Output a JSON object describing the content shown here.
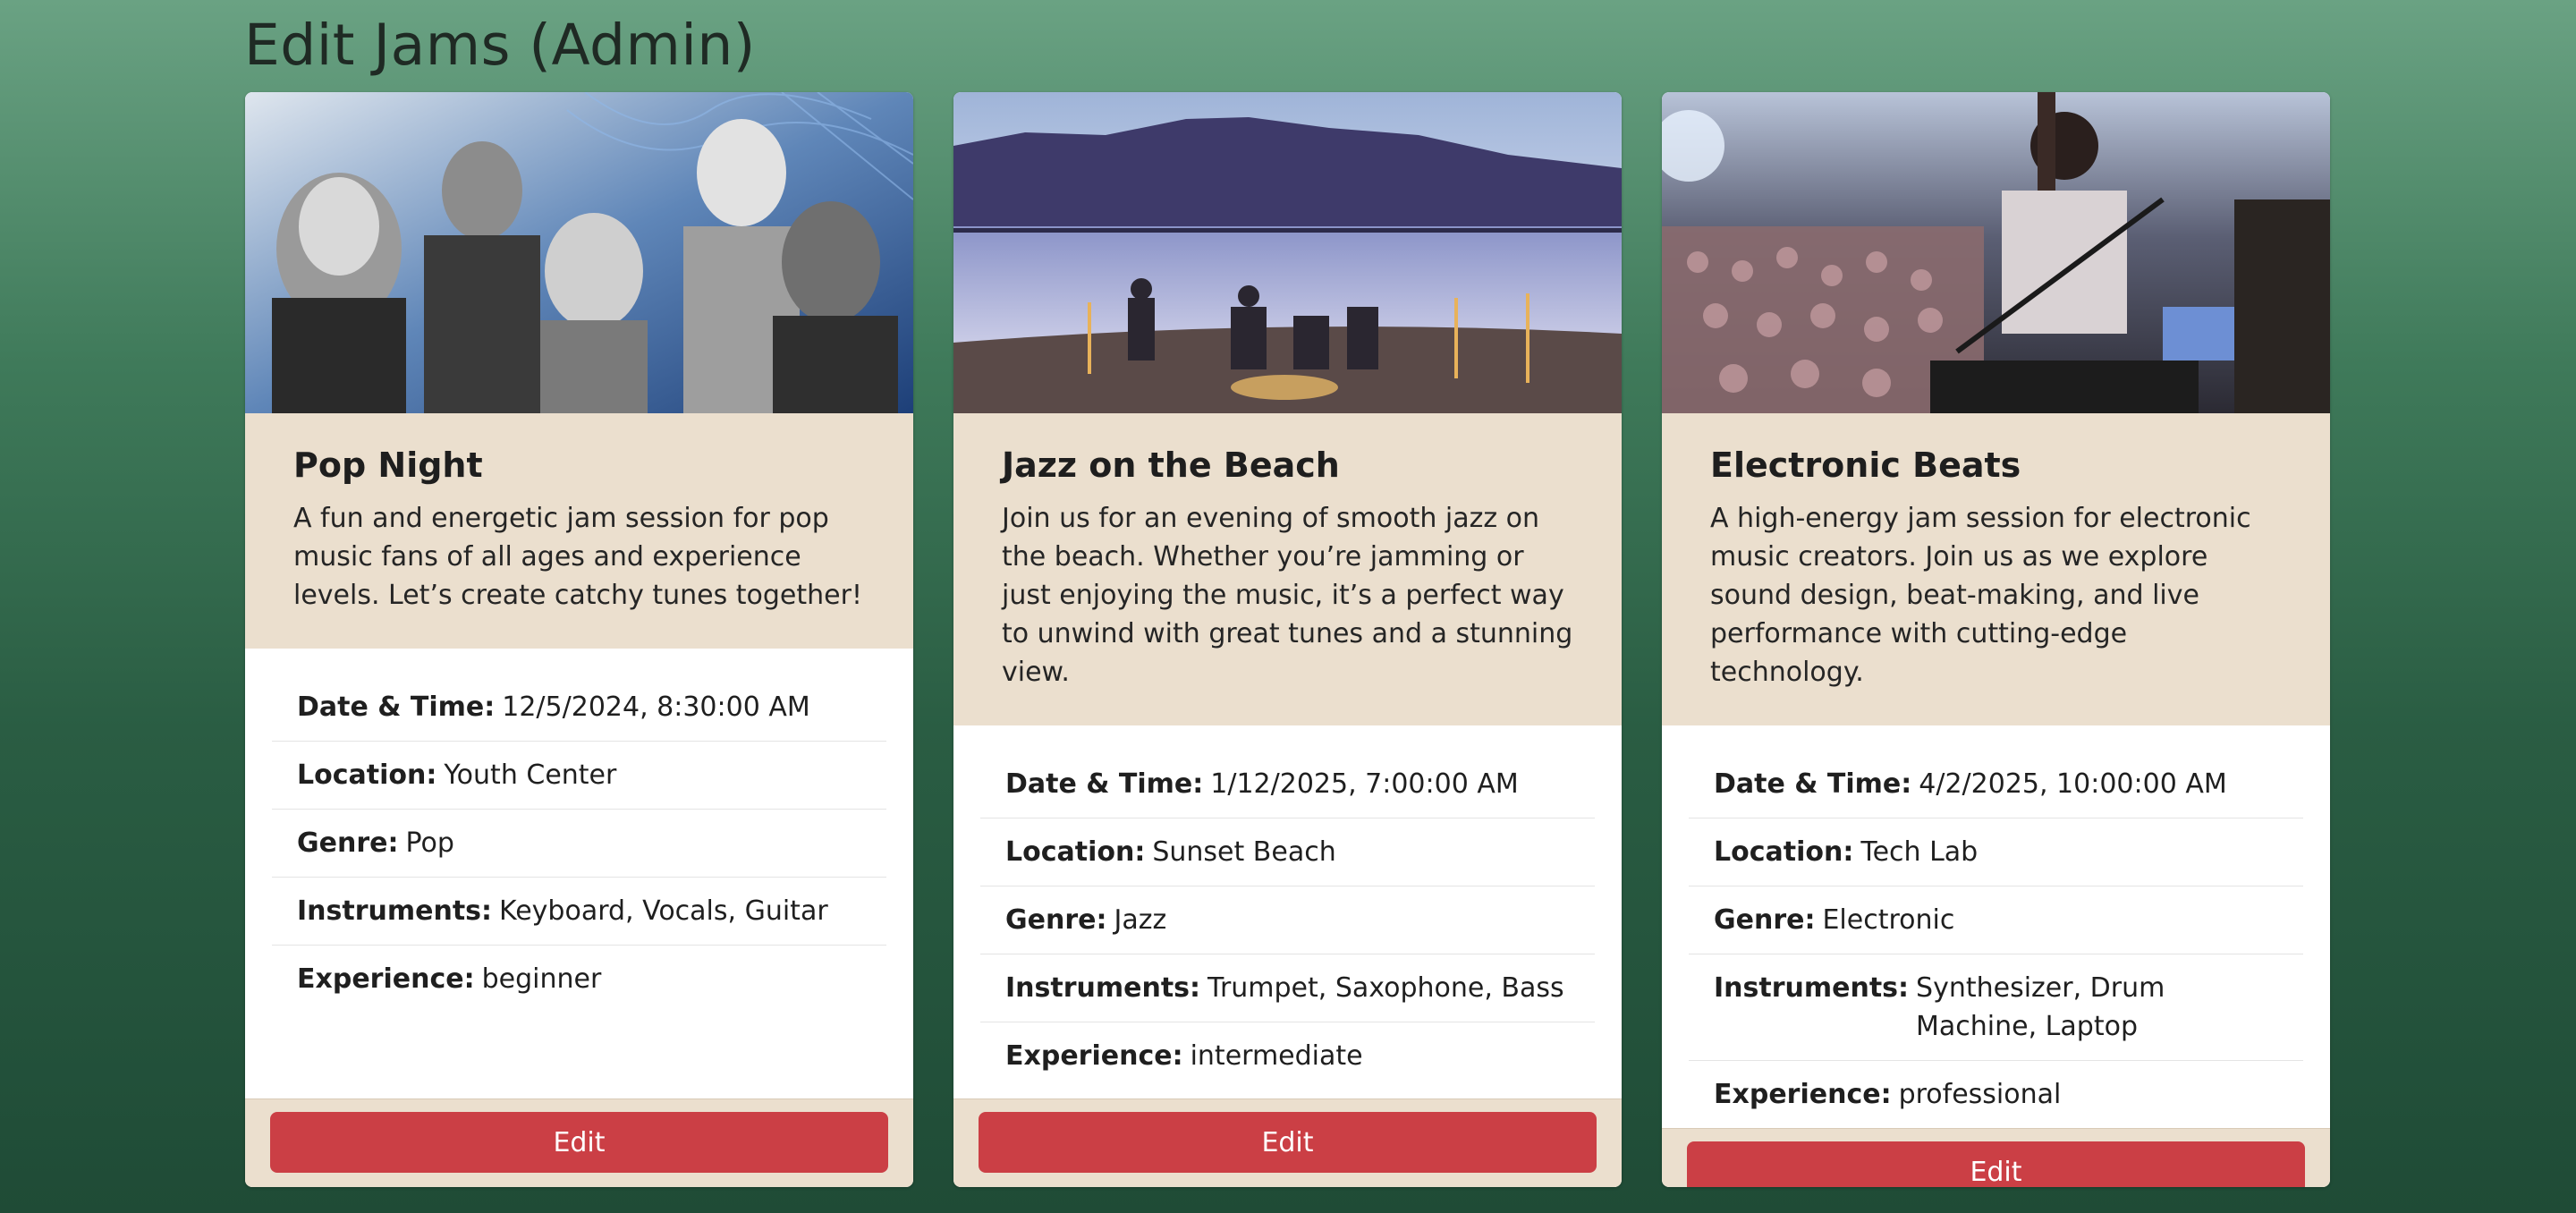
{
  "page": {
    "title": "Edit Jams (Admin)"
  },
  "colors": {
    "background_top": "#6aa283",
    "background_bottom": "#1f4b36",
    "card_accent": "#ebdfce",
    "edit_button": "#cb3f45"
  },
  "cards": [
    {
      "image_name": "pop-artists-collage-image",
      "title": "Pop Night",
      "description": "A fun and energetic jam session for pop music fans of all ages and experience levels. Let’s create catchy tunes together!",
      "details": [
        {
          "label": "Date & Time:",
          "value": "12/5/2024, 8:30:00 AM"
        },
        {
          "label": "Location:",
          "value": "Youth Center"
        },
        {
          "label": "Genre:",
          "value": "Pop"
        },
        {
          "label": "Instruments:",
          "value": "Keyboard, Vocals, Guitar"
        },
        {
          "label": "Experience:",
          "value": "beginner"
        }
      ],
      "button_label": "Edit"
    },
    {
      "image_name": "beach-jazz-image",
      "title": "Jazz on the Beach",
      "description": "Join us for an evening of smooth jazz on the beach. Whether you’re jamming or just enjoying the music, it’s a perfect way to unwind with great tunes and a stunning view.",
      "details": [
        {
          "label": "Date & Time:",
          "value": "1/12/2025, 7:00:00 AM"
        },
        {
          "label": "Location:",
          "value": "Sunset Beach"
        },
        {
          "label": "Genre:",
          "value": "Jazz"
        },
        {
          "label": "Instruments:",
          "value": "Trumpet, Saxophone, Bass"
        },
        {
          "label": "Experience:",
          "value": "intermediate"
        }
      ],
      "button_label": "Edit"
    },
    {
      "image_name": "electronic-concert-image",
      "title": "Electronic Beats",
      "description": "A high-energy jam session for electronic music creators. Join us as we explore sound design, beat-making, and live performance with cutting-edge technology.",
      "details": [
        {
          "label": "Date & Time:",
          "value": "4/2/2025, 10:00:00 AM"
        },
        {
          "label": "Location:",
          "value": "Tech Lab"
        },
        {
          "label": "Genre:",
          "value": "Electronic"
        },
        {
          "label": "Instruments:",
          "value": "Synthesizer, Drum Machine, Laptop"
        },
        {
          "label": "Experience:",
          "value": "professional"
        }
      ],
      "button_label": "Edit"
    }
  ]
}
